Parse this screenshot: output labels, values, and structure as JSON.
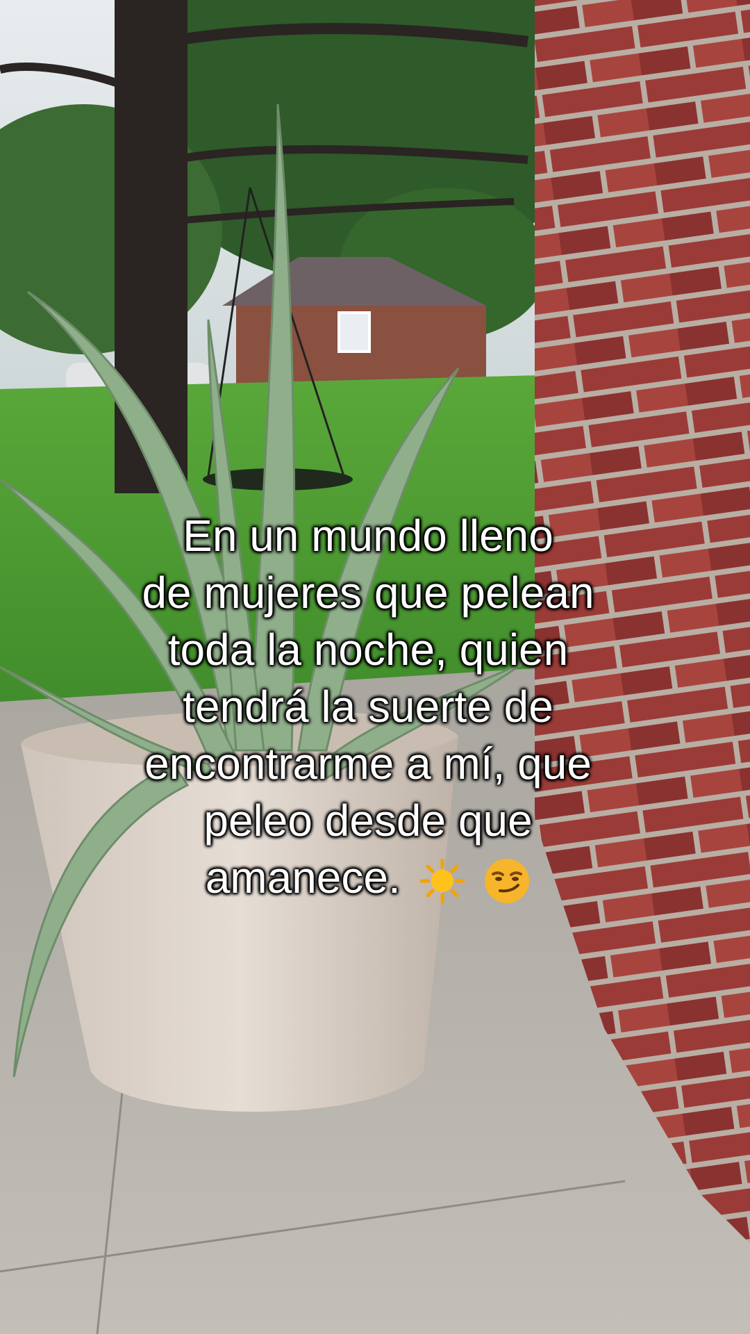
{
  "caption": {
    "lines": [
      "En un mundo lleno",
      "de mujeres que pelean",
      "toda la noche, quien",
      "tendrá la suerte de",
      "encontrarme a mí, que",
      "peleo desde que",
      "amanece."
    ],
    "emojis": [
      "sun-emoji",
      "smirking-face-emoji"
    ]
  },
  "colors": {
    "brick": "#9a3a36",
    "mortar": "#b9aea3",
    "grass": "#4f9a34",
    "pavement": "#b8b4ad",
    "pot": "#d9cfc6",
    "aloe": "#8fae8a"
  }
}
